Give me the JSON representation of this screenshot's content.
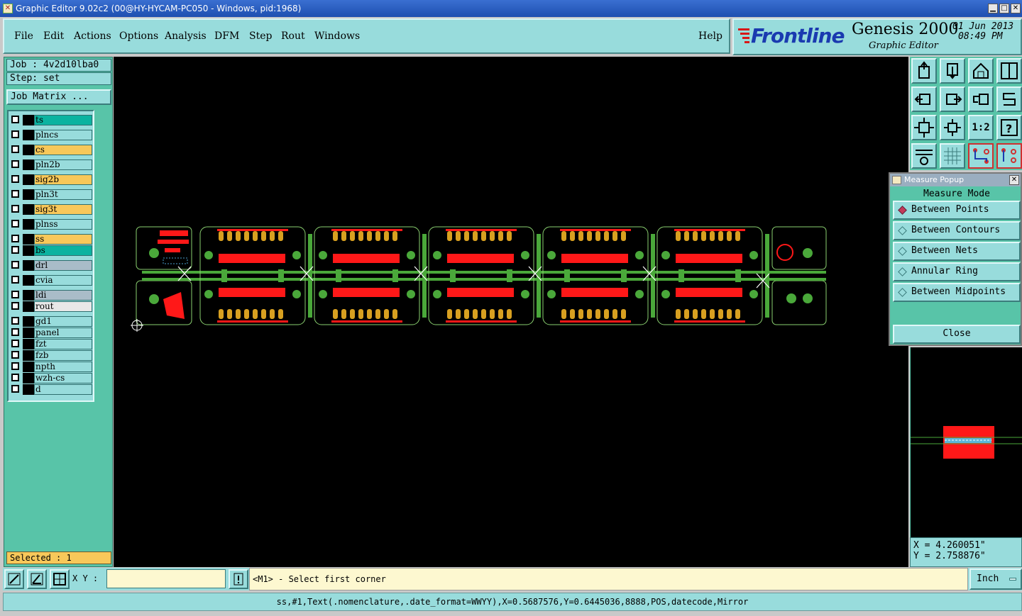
{
  "window": {
    "title": "Graphic Editor 9.02c2 (00@HY-HYCAM-PC050 - Windows, pid:1968)"
  },
  "menu": {
    "items": [
      "File",
      "Edit",
      "Actions",
      "Options",
      "Analysis",
      "DFM",
      "Step",
      "Rout",
      "Windows"
    ],
    "help": "Help"
  },
  "brand": {
    "logo": "Frontline",
    "product": "Genesis 2000",
    "subtitle": "Graphic Editor",
    "date": "01 Jun 2013",
    "time": "08:49 PM"
  },
  "job": {
    "job_label": "Job : 4v2d10lba0",
    "step_label": "Step: set",
    "matrix_button": "Job Matrix ..."
  },
  "layers": [
    {
      "name": "ts",
      "color": "#0bb3a0"
    },
    {
      "name": "plncs",
      "color": "#98dcdc"
    },
    {
      "name": "cs",
      "color": "#f8c85a"
    },
    {
      "name": "pln2b",
      "color": "#98dcdc"
    },
    {
      "name": "sig2b",
      "color": "#f8c85a"
    },
    {
      "name": "pln3t",
      "color": "#98dcdc"
    },
    {
      "name": "sig3t",
      "color": "#f8c85a"
    },
    {
      "name": "plnss",
      "color": "#98dcdc"
    },
    {
      "name": "ss",
      "color": "#f8c85a"
    },
    {
      "name": "bs",
      "color": "#0bb3a0"
    },
    {
      "name": "drl",
      "color": "#a9bcc8"
    },
    {
      "name": "cvia",
      "color": "#98dcdc"
    },
    {
      "name": "ldi",
      "color": "#a9bcc8"
    },
    {
      "name": "rout",
      "color": "#e8e8e8"
    },
    {
      "name": "gd1",
      "color": "#98dcdc"
    },
    {
      "name": "panel",
      "color": "#98dcdc"
    },
    {
      "name": "fzt",
      "color": "#98dcdc"
    },
    {
      "name": "fzb",
      "color": "#98dcdc"
    },
    {
      "name": "npth",
      "color": "#98dcdc"
    },
    {
      "name": "wzh-cs",
      "color": "#98dcdc"
    },
    {
      "name": "d",
      "color": "#98dcdc"
    }
  ],
  "selected": "Selected : 1",
  "measure": {
    "title": "Measure Popup",
    "mode_label": "Measure Mode",
    "options": [
      "Between Points",
      "Between Contours",
      "Between Nets",
      "Annular Ring",
      "Between Midpoints"
    ],
    "active": "Between Points",
    "close": "Close"
  },
  "coords": {
    "x": "X = 4.260051\"",
    "y": "Y = 2.758876\""
  },
  "bottom": {
    "xy_label": "X Y :",
    "xy_value": "",
    "prompt": "<M1> - Select first corner",
    "unit": "Inch"
  },
  "status": "ss,#1,Text(.nomenclature,.date_format=WWYY),X=0.5687576,Y=0.6445036,8888,POS,datecode,Mirror",
  "colors": {
    "board_green": "#4aa83a",
    "pad_red": "#ff1818",
    "pad_orange": "#d8a020",
    "outline": "#8ad070"
  }
}
